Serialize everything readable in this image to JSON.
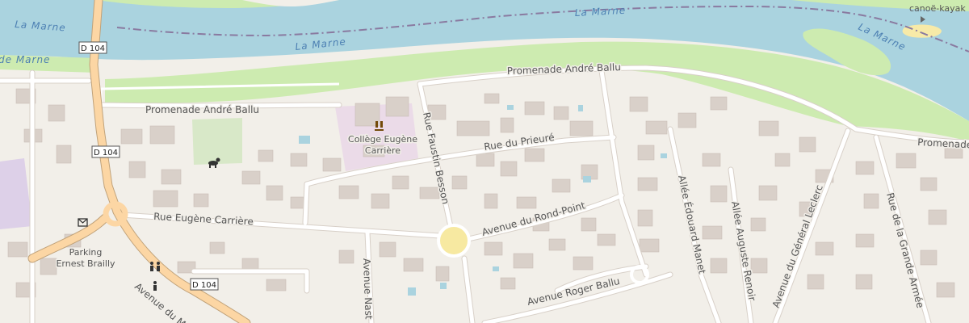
{
  "colors": {
    "background": "#f2efe9",
    "water": "#aad3df",
    "park": "#cdebb0",
    "school": "#ebdbe8",
    "building": "#d9d0c9",
    "primary_road": "#fcd6a4",
    "road": "#ffffff",
    "boundary": "#8a7aa0",
    "roundabout": "#f7e9a1"
  },
  "water": {
    "river_name_1": "La Marne",
    "river_name_2": "La Marne",
    "river_name_3": "La Marne",
    "river_name_4": "La Marne",
    "river_name_5": "de Marne"
  },
  "roads": {
    "promenade_west": "Promenade André Ballu",
    "promenade_north": "Promenade André Ballu",
    "promenade_east": "Promenade",
    "rue_faustin_besson": "Rue Faustin Besson",
    "rue_du_prieure": "Rue du Prieuré",
    "rue_eugene_carriere": "Rue Eugène Carrière",
    "avenue_rond_point": "Avenue du Rond-Point",
    "avenue_roger_ballu": "Avenue Roger Ballu",
    "allee_edouard_manet": "Allée Édouard Manet",
    "allee_auguste_renoir": "Allée Auguste Renoir",
    "avenue_general_leclerc": "Avenue du Général Leclerc",
    "rue_grande_armee": "Rue de la Grande Armée",
    "avenue_nast": "Avenue Nast",
    "avenue_du_ma": "Avenue du Ma"
  },
  "shields": {
    "d104_a": "D 104",
    "d104_b": "D 104",
    "d104_c": "D 104"
  },
  "pois": {
    "school_line1": "Collège Eugène",
    "school_line2": "Carrière",
    "parking_line1": "Parking",
    "parking_line2": "Ernest Brailly",
    "canoe": "canoë-kayak"
  },
  "icons": {
    "school": "school-icon",
    "dog_park": "dog-park-icon",
    "toilets": "toilets-icon",
    "post": "post-office-icon"
  }
}
